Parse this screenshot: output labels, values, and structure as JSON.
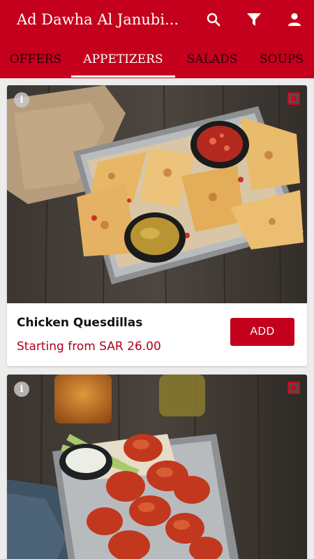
{
  "header": {
    "title": "Ad Dawha Al Janubi...",
    "icons": [
      "search-icon",
      "filter-icon",
      "account-icon"
    ]
  },
  "tabs": [
    {
      "label": "OFFERS",
      "active": false
    },
    {
      "label": "APPETIZERS",
      "active": true
    },
    {
      "label": "SALADS",
      "active": false
    },
    {
      "label": "SOUPS",
      "active": false
    }
  ],
  "items": [
    {
      "name": "Chicken Quesdillas",
      "price": "Starting from SAR 26.00",
      "action": "ADD"
    },
    {
      "name": "",
      "price": "",
      "action": ""
    }
  ],
  "colors": {
    "brand": "#c4001c",
    "price": "#b0001a",
    "background": "#ececec"
  }
}
